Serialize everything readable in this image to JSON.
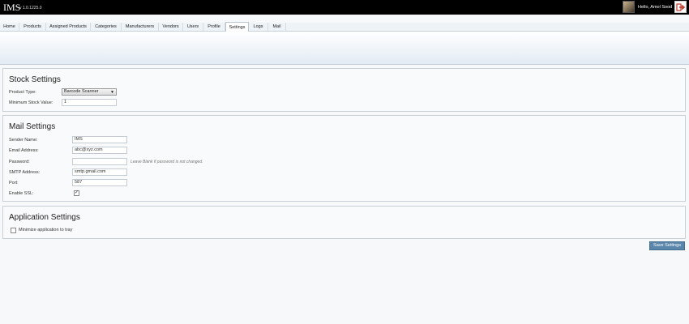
{
  "window": {
    "title": "IMS",
    "version": "v 1.0.1225.0",
    "greeting": "Hello, Amol Sood",
    "logout_icon": "logout-arrow-icon"
  },
  "tabs": [
    {
      "label": "Home"
    },
    {
      "label": "Products"
    },
    {
      "label": "Assigned Products"
    },
    {
      "label": "Categories"
    },
    {
      "label": "Manufacturers"
    },
    {
      "label": "Vendors"
    },
    {
      "label": "Users"
    },
    {
      "label": "Profile"
    },
    {
      "label": "Settings",
      "active": true
    },
    {
      "label": "Logs"
    },
    {
      "label": "Mail"
    }
  ],
  "stock": {
    "title": "Stock Settings",
    "product_type_label": "Product Type:",
    "product_type_value": "Barcode Scanner",
    "min_stock_label": "Minimum Stock Value:",
    "min_stock_value": "1"
  },
  "mail": {
    "title": "Mail Settings",
    "sender_name_label": "Sender Name:",
    "sender_name_value": "IMS",
    "email_label": "Email Address:",
    "email_value": "abc@xyz.com",
    "password_label": "Password:",
    "password_value": "",
    "password_hint": "Leave Blank if password is not changed.",
    "smtp_label": "SMTP Address:",
    "smtp_value": "smtp.gmail.com",
    "port_label": "Port:",
    "port_value": "587",
    "ssl_label": "Enable SSL:",
    "ssl_checked": true,
    "ssl_mark": "✓"
  },
  "application": {
    "title": "Application Settings",
    "minimize_label": "Minimize application to tray",
    "minimize_checked": false
  },
  "actions": {
    "save_label": "Save Settings",
    "accent_color": "#5b86ab"
  }
}
